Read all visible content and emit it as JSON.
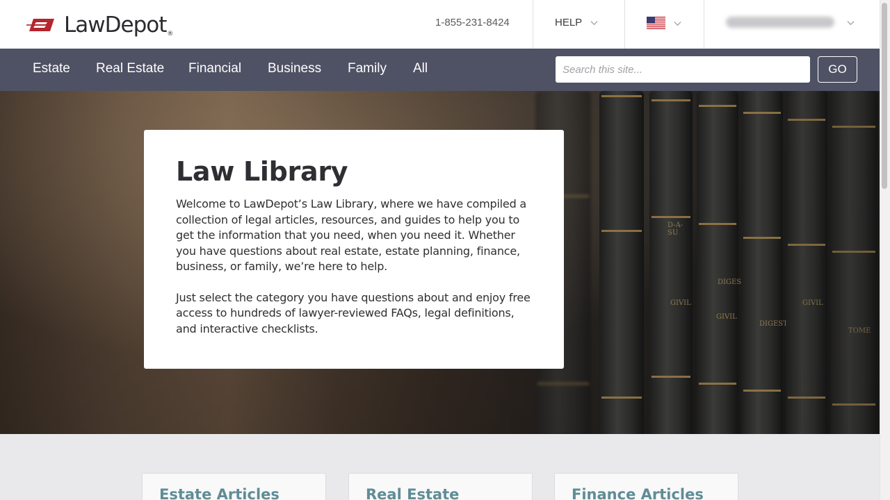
{
  "header": {
    "logo_text": "LawDepot",
    "logo_reg": "®",
    "phone": "1-855-231-8424",
    "help_label": "HELP",
    "country_flag_icon": "us-flag-icon",
    "account_email": "[redacted email]"
  },
  "nav": {
    "items": [
      {
        "label": "Estate"
      },
      {
        "label": "Real Estate"
      },
      {
        "label": "Financial"
      },
      {
        "label": "Business"
      },
      {
        "label": "Family"
      },
      {
        "label": "All"
      }
    ],
    "search_placeholder": "Search this site...",
    "go_label": "GO"
  },
  "hero": {
    "title": "Law Library",
    "paragraph1": "Welcome to LawDepot’s Law Library, where we have compiled a collection of legal articles, resources, and guides to help you to get the information that you need, when you need it. Whether you have questions about real estate, estate planning, finance, business, or family, we’re here to help.",
    "paragraph2": "Just select the category you have questions about and enjoy free access to hundreds of lawyer-reviewed FAQs, legal definitions, and interactive checklists.",
    "spines": [
      "D-A-SU",
      "GIVIL",
      "DIGEST",
      "GIVIL",
      "DIGEST",
      "GIVIL",
      "TOME"
    ]
  },
  "articles": [
    {
      "title": "Estate Articles"
    },
    {
      "title": "Real Estate Articles"
    },
    {
      "title": "Finance Articles"
    }
  ],
  "colors": {
    "nav_bg": "#4f5264",
    "accent_red": "#b5262d",
    "article_title": "#5f8d96"
  }
}
